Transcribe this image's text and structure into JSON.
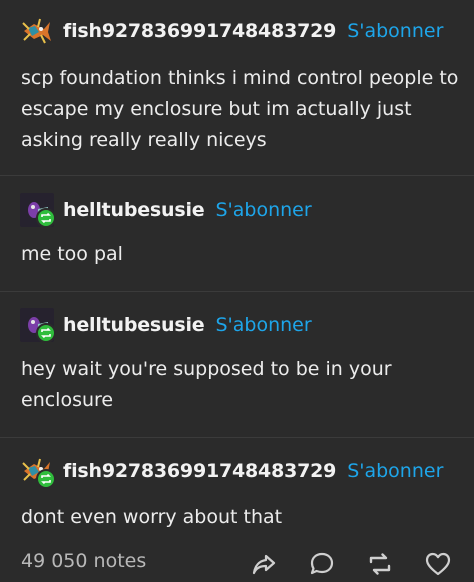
{
  "posts": [
    {
      "username": "fish927836991748483729",
      "follow_label": "S'abonner",
      "body": "scp foundation thinks i mind control people to escape my enclosure but im actually just asking really really niceys",
      "reblogged": false,
      "avatar_icon": "fish-avatar"
    },
    {
      "username": "helltubesusie",
      "follow_label": "S'abonner",
      "body": "me too pal",
      "reblogged": true,
      "avatar_icon": "susie-avatar"
    },
    {
      "username": "helltubesusie",
      "follow_label": "S'abonner",
      "body": "hey wait you're supposed to be in your enclosure",
      "reblogged": true,
      "avatar_icon": "susie-avatar"
    },
    {
      "username": "fish927836991748483729",
      "follow_label": "S'abonner",
      "body": "dont even worry about that",
      "reblogged": true,
      "avatar_icon": "fish-avatar"
    }
  ],
  "footer": {
    "notes": "49 050 notes",
    "icons": [
      "share-icon",
      "reply-icon",
      "reblog-icon",
      "like-icon"
    ]
  },
  "colors": {
    "background": "#2b2b2b",
    "accent": "#1ea5e9",
    "reblog_badge": "#2fbd3c"
  }
}
